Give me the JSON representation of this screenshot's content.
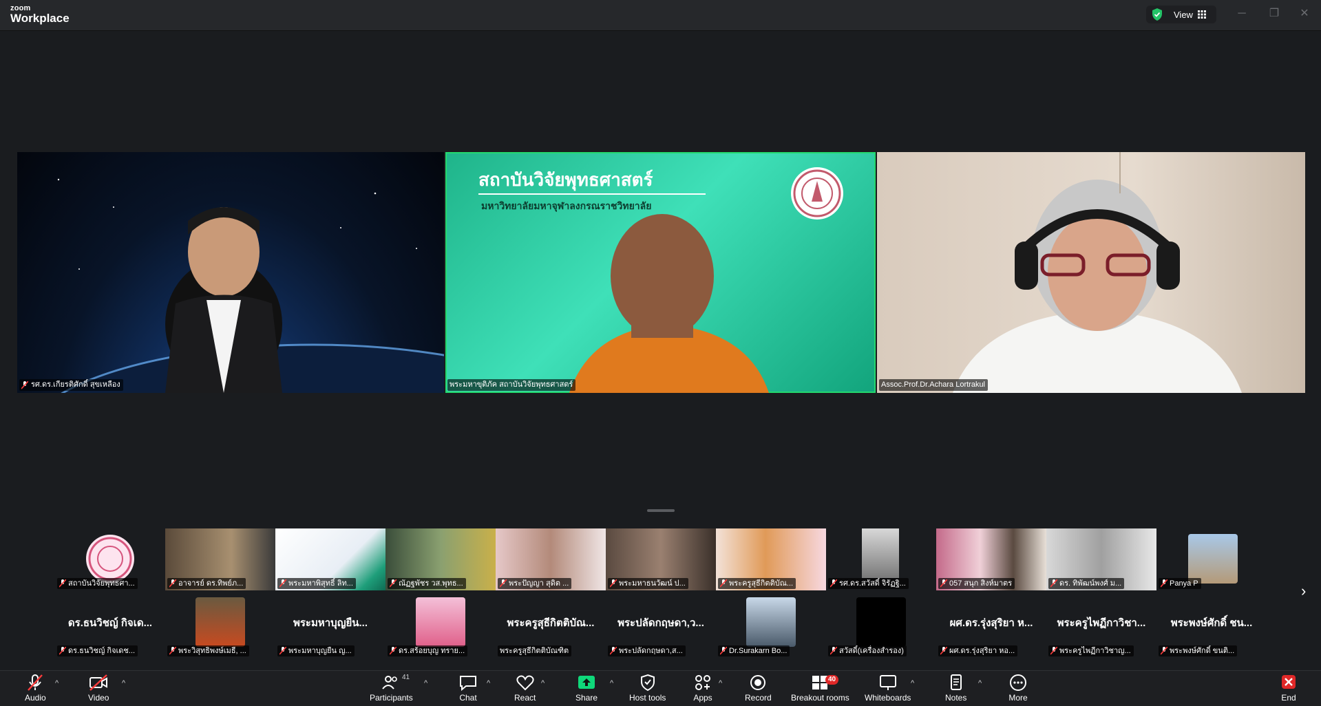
{
  "app": {
    "logo_small": "zoom",
    "logo_big": "Workplace",
    "view_label": "View"
  },
  "main_tiles": [
    {
      "name": "รศ.ดร.เกียรติศักดิ์ สุขเหลือง"
    },
    {
      "name": "พระมหาขุติภัค สถาบันวิจัยพุทธศาสตร์",
      "slide_title": "สถาบันวิจัยพุทธศาสตร์",
      "slide_subtitle": "มหาวิทยาลัยมหาจุฬาลงกรณราชวิทยาลัย"
    },
    {
      "name": "Assoc.Prof.Dr.Achara Lortrakul"
    }
  ],
  "strip_row1": [
    "สถาบันวิจัยพุทธศา...",
    "อาจารย์ ดร.ทิพย์ภ...",
    "พระมหาพิสุทธิ์ ลิท...",
    "ณัฏฐพัชร วส.พุทธ...",
    "พระปัญญา สุดิต ...",
    "พระมหาธนวัฒน์ ป...",
    "พระครูสุธีกิตติบัณ...",
    "รศ.ดร.สวัสดิ์ จิรัฏฐิ...",
    "057 สนุก สิงห์มาตร",
    "ดร. ทิพัฒน์พงศ์ ม...",
    "Panya P"
  ],
  "strip_row2": [
    {
      "big": "ดร.ธนวิชญ์ กิจเด...",
      "name": "ดร.ธนวิชญ์ กิจเดช..."
    },
    {
      "big": "",
      "name": "พระวิสุทธิพงษ์เมธี, ..."
    },
    {
      "big": "พระมหาบุญยืน...",
      "name": "พระมหาบุญยืน  ญ..."
    },
    {
      "big": "",
      "name": "ดร.สร้อยบุญ ทราย..."
    },
    {
      "big": "พระครูสุธีกิตติบัณ...",
      "name": "พระครูสุธีกิตติบัณฑิต"
    },
    {
      "big": "พระปลัดกฤษดา,ว...",
      "name": "พระปลัดกฤษดา,ส..."
    },
    {
      "big": "",
      "name": "Dr.Surakarn Bo..."
    },
    {
      "big": "",
      "name": "สวัสดิ์(เครื่องสำรอง)"
    },
    {
      "big": "ผศ.ดร.รุ่งสุริยา ห...",
      "name": "ผศ.ดร.รุ่งสุริยา หอ..."
    },
    {
      "big": "พระครูไพฏีกาวิชา...",
      "name": "พระครูไพฏีกาวิชาญ..."
    },
    {
      "big": "พระพงษ์ศักดิ์ ชน...",
      "name": "พระพงษ์ศักดิ์ ขนติ..."
    }
  ],
  "toolbar": {
    "audio": "Audio",
    "video": "Video",
    "participants": "Participants",
    "participants_count": "41",
    "chat": "Chat",
    "react": "React",
    "share": "Share",
    "host_tools": "Host tools",
    "apps": "Apps",
    "record": "Record",
    "breakout": "Breakout rooms",
    "breakout_badge": "40",
    "whiteboards": "Whiteboards",
    "notes": "Notes",
    "more": "More",
    "end": "End"
  },
  "colors": {
    "speaker_outline": "#23d96e",
    "share_green": "#0fd87a",
    "end_red": "#e02828"
  }
}
